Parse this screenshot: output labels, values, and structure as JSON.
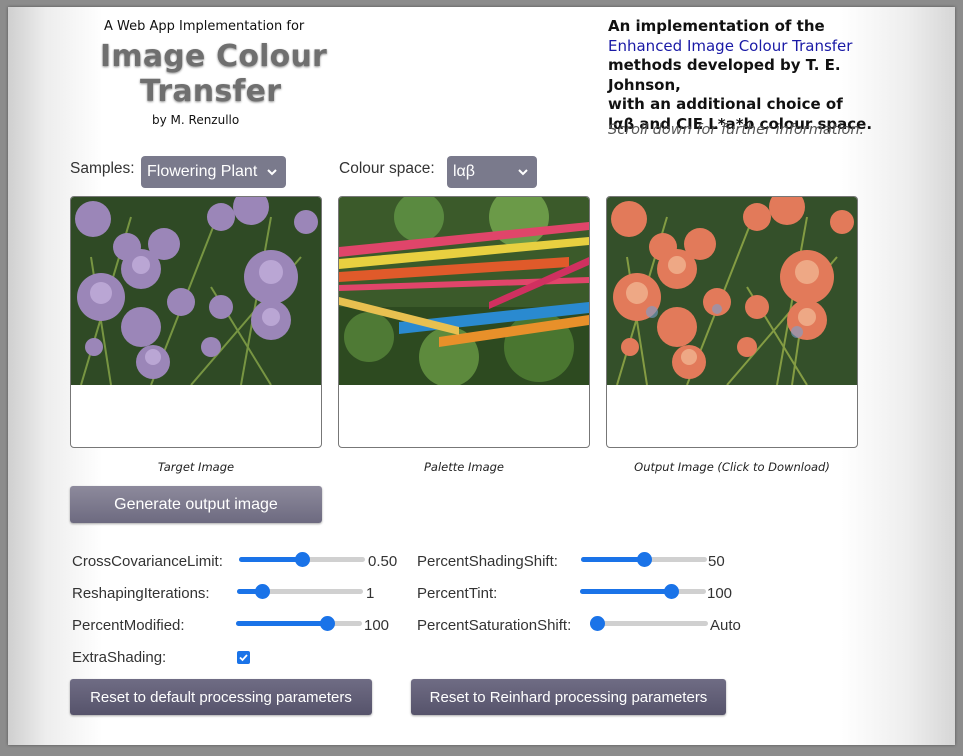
{
  "header": {
    "subtitle": "A Web App Implementation for",
    "title_line1": "Image Colour",
    "title_line2": "Transfer",
    "byline": "by M. Renzullo"
  },
  "description": {
    "line1": "An implementation of the",
    "link": "Enhanced Image Colour Transfer",
    "line3": "methods developed by T. E. Johnson,",
    "line4": "with an additional choice of",
    "line5": "lαβ and CIE L*a*b colour space.",
    "scroll_hint": "Scroll down for further information."
  },
  "controls": {
    "samples_label": "Samples:",
    "samples_value": "Flowering Plant",
    "colour_space_label": "Colour space:",
    "colour_space_value": "lαβ"
  },
  "images": {
    "target_caption": "Target Image",
    "palette_caption": "Palette Image",
    "output_caption": "Output Image (Click to Download)"
  },
  "generate_button": "Generate output image",
  "params": {
    "cross_covariance": {
      "label": "CrossCovarianceLimit:",
      "value": "0.50",
      "fraction": 0.5
    },
    "reshaping_iterations": {
      "label": "ReshapingIterations:",
      "value": "1",
      "fraction": 0.2
    },
    "percent_modified": {
      "label": "PercentModified:",
      "value": "100",
      "fraction": 0.72
    },
    "extra_shading": {
      "label": "ExtraShading:",
      "checked": true
    },
    "percent_shading_shift": {
      "label": "PercentShadingShift:",
      "value": "50",
      "fraction": 0.5
    },
    "percent_tint": {
      "label": "PercentTint:",
      "value": "100",
      "fraction": 0.72
    },
    "percent_saturation_shift": {
      "label": "PercentSaturationShift:",
      "value": "Auto",
      "fraction": 0.0
    }
  },
  "reset_default_button": "Reset to default processing parameters",
  "reset_reinhard_button": "Reset to Reinhard processing parameters",
  "colors": {
    "accent": "#1a73e8",
    "button": "#7a7a8c",
    "link": "#1a1aa6"
  }
}
